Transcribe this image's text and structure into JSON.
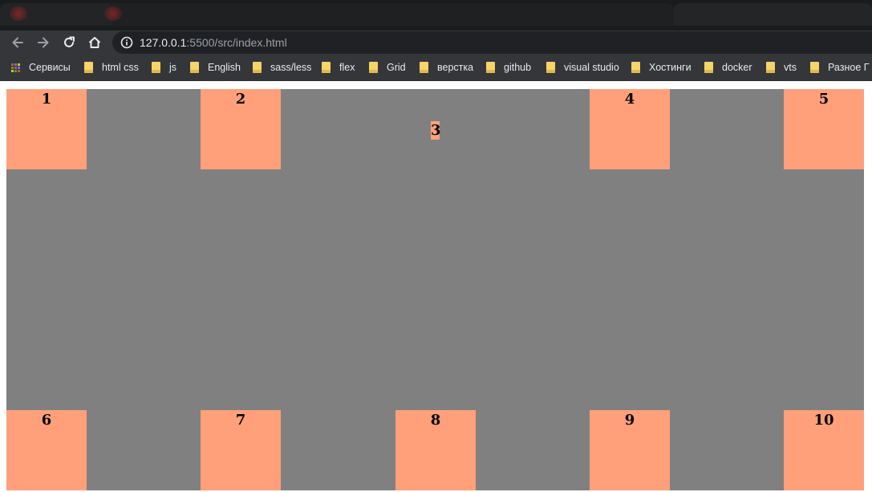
{
  "browser": {
    "url_host": "127.0.0.1",
    "url_rest": ":5500/src/index.html",
    "bookmarks": [
      {
        "label": "Сервисы",
        "icon": "apps-grid-icon"
      },
      {
        "label": "html css",
        "icon": "folder-icon"
      },
      {
        "label": "js",
        "icon": "folder-icon"
      },
      {
        "label": "English",
        "icon": "folder-icon"
      },
      {
        "label": "sass/less",
        "icon": "folder-icon"
      },
      {
        "label": "flex",
        "icon": "folder-icon"
      },
      {
        "label": "Grid",
        "icon": "folder-icon"
      },
      {
        "label": "верстка",
        "icon": "folder-icon"
      },
      {
        "label": "github",
        "icon": "folder-icon"
      },
      {
        "label": "visual studio",
        "icon": "folder-icon"
      },
      {
        "label": "Хостинги",
        "icon": "folder-icon"
      },
      {
        "label": "docker",
        "icon": "folder-icon"
      },
      {
        "label": "vts",
        "icon": "folder-icon"
      },
      {
        "label": "Разное Г",
        "icon": "folder-icon"
      }
    ]
  },
  "page": {
    "container_color": "#808080",
    "box_color": "#ffa07a",
    "boxes": [
      "1",
      "2",
      "3",
      "4",
      "5",
      "6",
      "7",
      "8",
      "9",
      "10"
    ]
  }
}
